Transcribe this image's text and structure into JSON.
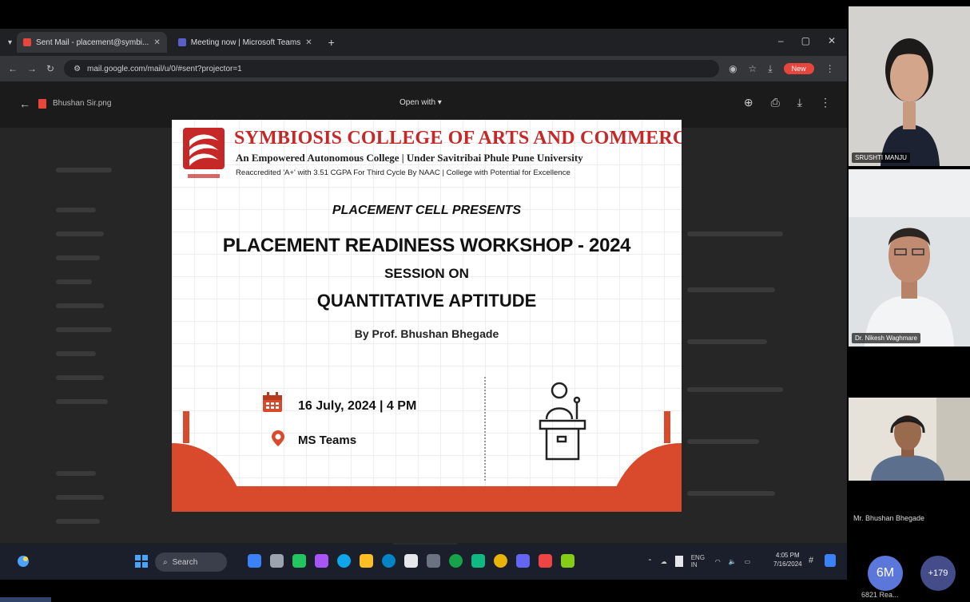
{
  "browser": {
    "tabs": [
      {
        "label": "Sent Mail - placement@symbi...",
        "active": true,
        "favicon_color": "#e8453c"
      },
      {
        "label": "Meeting now | Microsoft Teams",
        "active": false,
        "favicon_color": "#5b5fc7"
      }
    ],
    "new_tab": "+",
    "window_controls": [
      "–",
      "▢",
      "✕"
    ],
    "url": "mail.google.com/mail/u/0/#sent?projector=1",
    "new_button": "New"
  },
  "viewer": {
    "file_name": "Bhushan Sir.png",
    "open_with": "Open with ▾",
    "tools": [
      "add-icon",
      "print-icon",
      "download-icon",
      "more-icon"
    ]
  },
  "poster": {
    "college_name": "SYMBIOSIS COLLEGE OF ARTS AND COMMERCE",
    "college_subtitle": "An Empowered Autonomous College | Under Savitribai Phule Pune University",
    "accreditation": "Reaccredited 'A+' with 3.51 CGPA For Third Cycle By NAAC | College with Potential for Excellence",
    "presents": "PLACEMENT CELL PRESENTS",
    "title": "PLACEMENT READINESS WORKSHOP - 2024",
    "session_on": "SESSION ON",
    "topic": "QUANTITATIVE APTITUDE",
    "by": "By Prof. Bhushan Bhegade",
    "date": "16 July, 2024 | 4 PM",
    "venue": "MS Teams",
    "accent_color": "#d84a2b",
    "title_color": "#c62828"
  },
  "zoom_controls": {
    "minus": "−",
    "zoom": "🔍",
    "plus": "+"
  },
  "taskbar": {
    "search_label": "Search",
    "tray_language": "ENG IN",
    "clock_time": "4:05 PM",
    "clock_date": "7/16/2024"
  },
  "participants": [
    {
      "name": "SRUSHTI MANJU"
    },
    {
      "name": "Dr. Nikesh Waghmare"
    },
    {
      "name": "Mr. Bhushan Bhegade"
    }
  ],
  "overflow": {
    "initials": "6M",
    "label": "6821 Rea...",
    "more_count": "+179"
  }
}
